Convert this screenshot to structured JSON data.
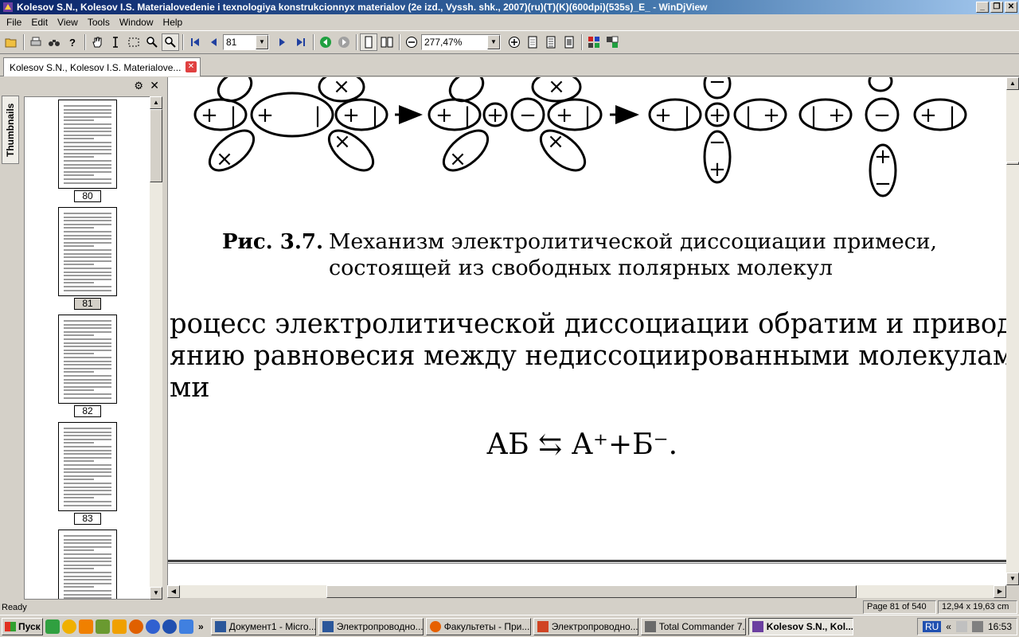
{
  "window": {
    "title": "Kolesov S.N., Kolesov I.S. Materialovedenie i texnologiya konstrukcionnyx materialov (2e izd., Vyssh. shk., 2007)(ru)(T)(K)(600dpi)(535s)_E_ - WinDjView",
    "minimize": "_",
    "restore": "❐",
    "close": "✕"
  },
  "menu": [
    "File",
    "Edit",
    "View",
    "Tools",
    "Window",
    "Help"
  ],
  "toolbar": {
    "page_number": "81",
    "zoom": "277,47%"
  },
  "tab": {
    "label": "Kolesov S.N., Kolesov I.S. Materialove...",
    "close": "✕"
  },
  "sidebar": {
    "tab_label": "Thumbnails",
    "settings_icon": "⚙",
    "close_icon": "✕",
    "thumbnails": [
      {
        "label": "80",
        "selected": false
      },
      {
        "label": "81",
        "selected": true
      },
      {
        "label": "82",
        "selected": false
      },
      {
        "label": "83",
        "selected": false
      }
    ]
  },
  "page": {
    "figure": {
      "charge_plus": "+",
      "charge_minus": "−",
      "charge_x": "×",
      "charge_bar": "|"
    },
    "caption_bold": "Рис. 3.7.",
    "caption_line1": "Механизм электролитической диссоциации примеси,",
    "caption_line2": "состоящей из свободных полярных молекул",
    "body_line1": "роцесс электролитической диссоциации обратим и привод",
    "body_line2": "янию равновесия между недиссоциированными молекулам",
    "body_line3": "ми",
    "equation": "АБ ⇆ А⁺+Б⁻."
  },
  "status": {
    "ready": "Ready",
    "page": "Page 81 of 540",
    "size": "12,94 x 19,63 cm"
  },
  "taskbar": {
    "start": "Пуск",
    "chevron": "»",
    "tasks": [
      {
        "label": "Документ1 - Micro...",
        "color": "#2b579a",
        "active": false
      },
      {
        "label": "Электропроводно...",
        "color": "#2b579a",
        "active": false
      },
      {
        "label": "Факультеты - При...",
        "color": "#e66000",
        "active": false
      },
      {
        "label": "Электропроводно...",
        "color": "#d04423",
        "active": false
      },
      {
        "label": "Total Commander 7...",
        "color": "#6a6a6a",
        "active": false
      },
      {
        "label": "Kolesov S.N., Kol...",
        "color": "#6b3fa0",
        "active": true
      }
    ],
    "tray": {
      "lang": "RU",
      "arrows": "«",
      "time": "16:53"
    }
  }
}
